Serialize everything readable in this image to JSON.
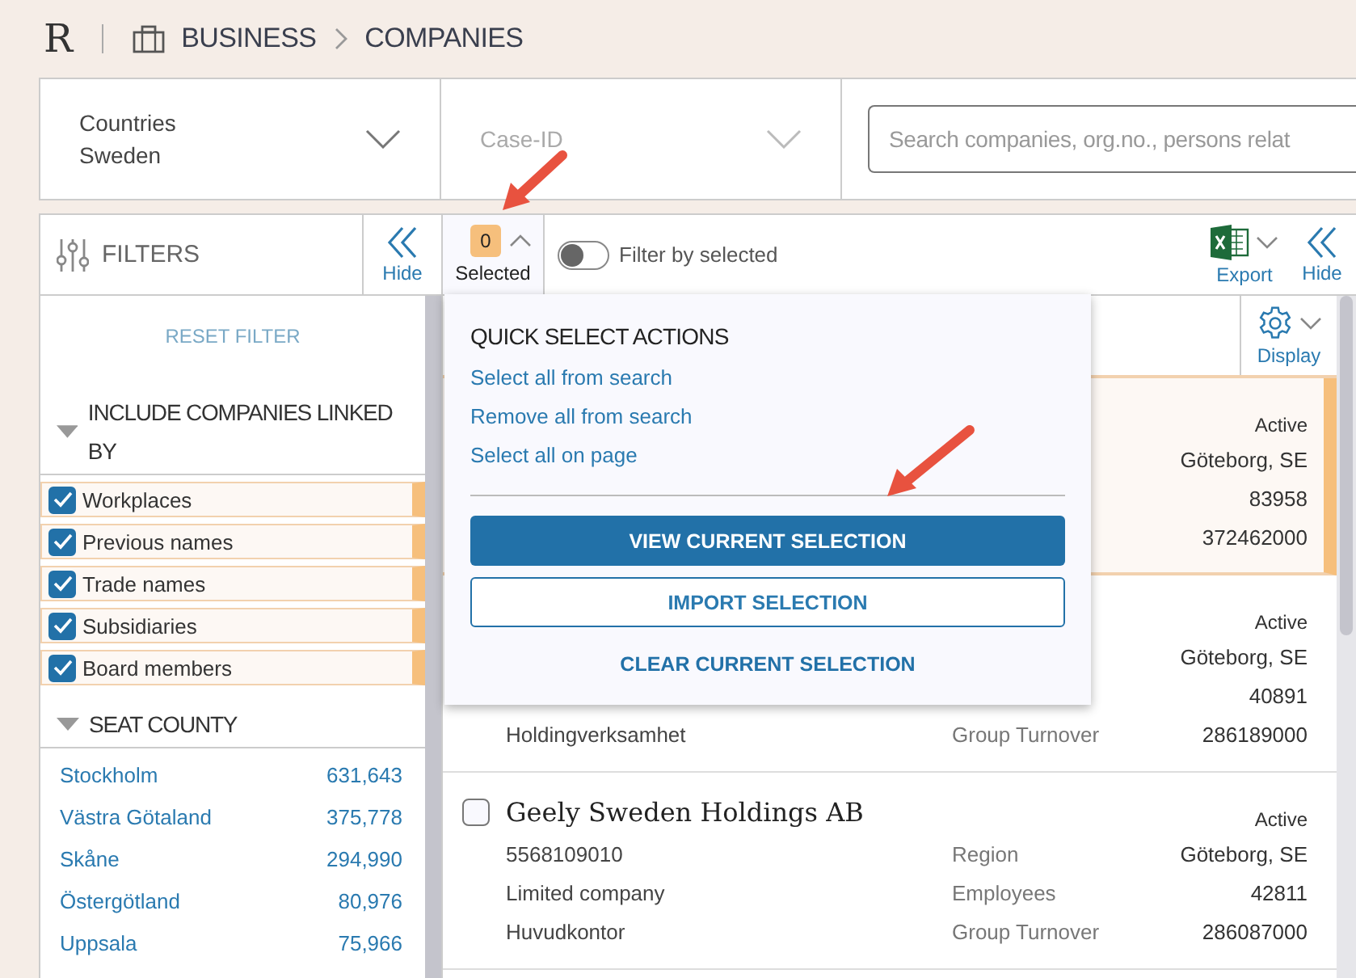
{
  "header": {
    "logo": "R",
    "breadcrumb": [
      "BUSINESS",
      "COMPANIES"
    ]
  },
  "search_bar": {
    "countries": {
      "label": "Countries",
      "value": "Sweden"
    },
    "case_id": {
      "placeholder": "Case-ID"
    },
    "search": {
      "placeholder": "Search companies, org.no., persons relat"
    }
  },
  "toolbar": {
    "filters_title": "FILTERS",
    "hide_filters": "Hide",
    "selected_count": "0",
    "selected_label": "Selected",
    "filter_by_selected": {
      "label": "Filter by selected",
      "on": false
    },
    "export": "Export",
    "hide": "Hide",
    "display": "Display"
  },
  "sidebar": {
    "reset": "RESET FILTER",
    "sections": [
      {
        "title": "INCLUDE COMPANIES LINKED BY",
        "expanded": true,
        "kind": "checkboxes",
        "items": [
          {
            "label": "Workplaces",
            "checked": true
          },
          {
            "label": "Previous names",
            "checked": true
          },
          {
            "label": "Trade names",
            "checked": true
          },
          {
            "label": "Subsidiaries",
            "checked": true
          },
          {
            "label": "Board members",
            "checked": true
          }
        ]
      },
      {
        "title": "SEAT COUNTY",
        "expanded": true,
        "kind": "counts",
        "items": [
          {
            "label": "Stockholm",
            "count": "631,643"
          },
          {
            "label": "Västra Götaland",
            "count": "375,778"
          },
          {
            "label": "Skåne",
            "count": "294,990"
          },
          {
            "label": "Östergötland",
            "count": "80,976"
          },
          {
            "label": "Uppsala",
            "count": "75,966"
          }
        ]
      }
    ]
  },
  "quick_select": {
    "title": "QUICK SELECT ACTIONS",
    "links": [
      "Select all from search",
      "Remove all from search",
      "Select all on page"
    ],
    "buttons": [
      {
        "label": "VIEW CURRENT SELECTION",
        "kind": "primary"
      },
      {
        "label": "IMPORT SELECTION",
        "kind": "outline"
      },
      {
        "label": "CLEAR CURRENT SELECTION",
        "kind": "text"
      }
    ]
  },
  "results": [
    {
      "selected": true,
      "status": "Active",
      "lines": [
        {
          "value": "Göteborg, SE"
        },
        {
          "value": "83958"
        },
        {
          "value": "372462000"
        }
      ]
    },
    {
      "selected": false,
      "status": "Active",
      "lines": [
        {
          "value": "Göteborg, SE"
        },
        {
          "value": "40891"
        },
        {
          "info": "Holdingverksamhet",
          "label": "Group Turnover",
          "value": "286189000"
        }
      ]
    },
    {
      "selected": false,
      "checked": false,
      "name": "Geely Sweden Holdings AB",
      "status": "Active",
      "lines": [
        {
          "info": "5568109010",
          "label": "Region",
          "value": "Göteborg, SE"
        },
        {
          "info": "Limited company",
          "label": "Employees",
          "value": "42811"
        },
        {
          "info": "Huvudkontor",
          "label": "Group Turnover",
          "value": "286087000"
        }
      ]
    }
  ]
}
